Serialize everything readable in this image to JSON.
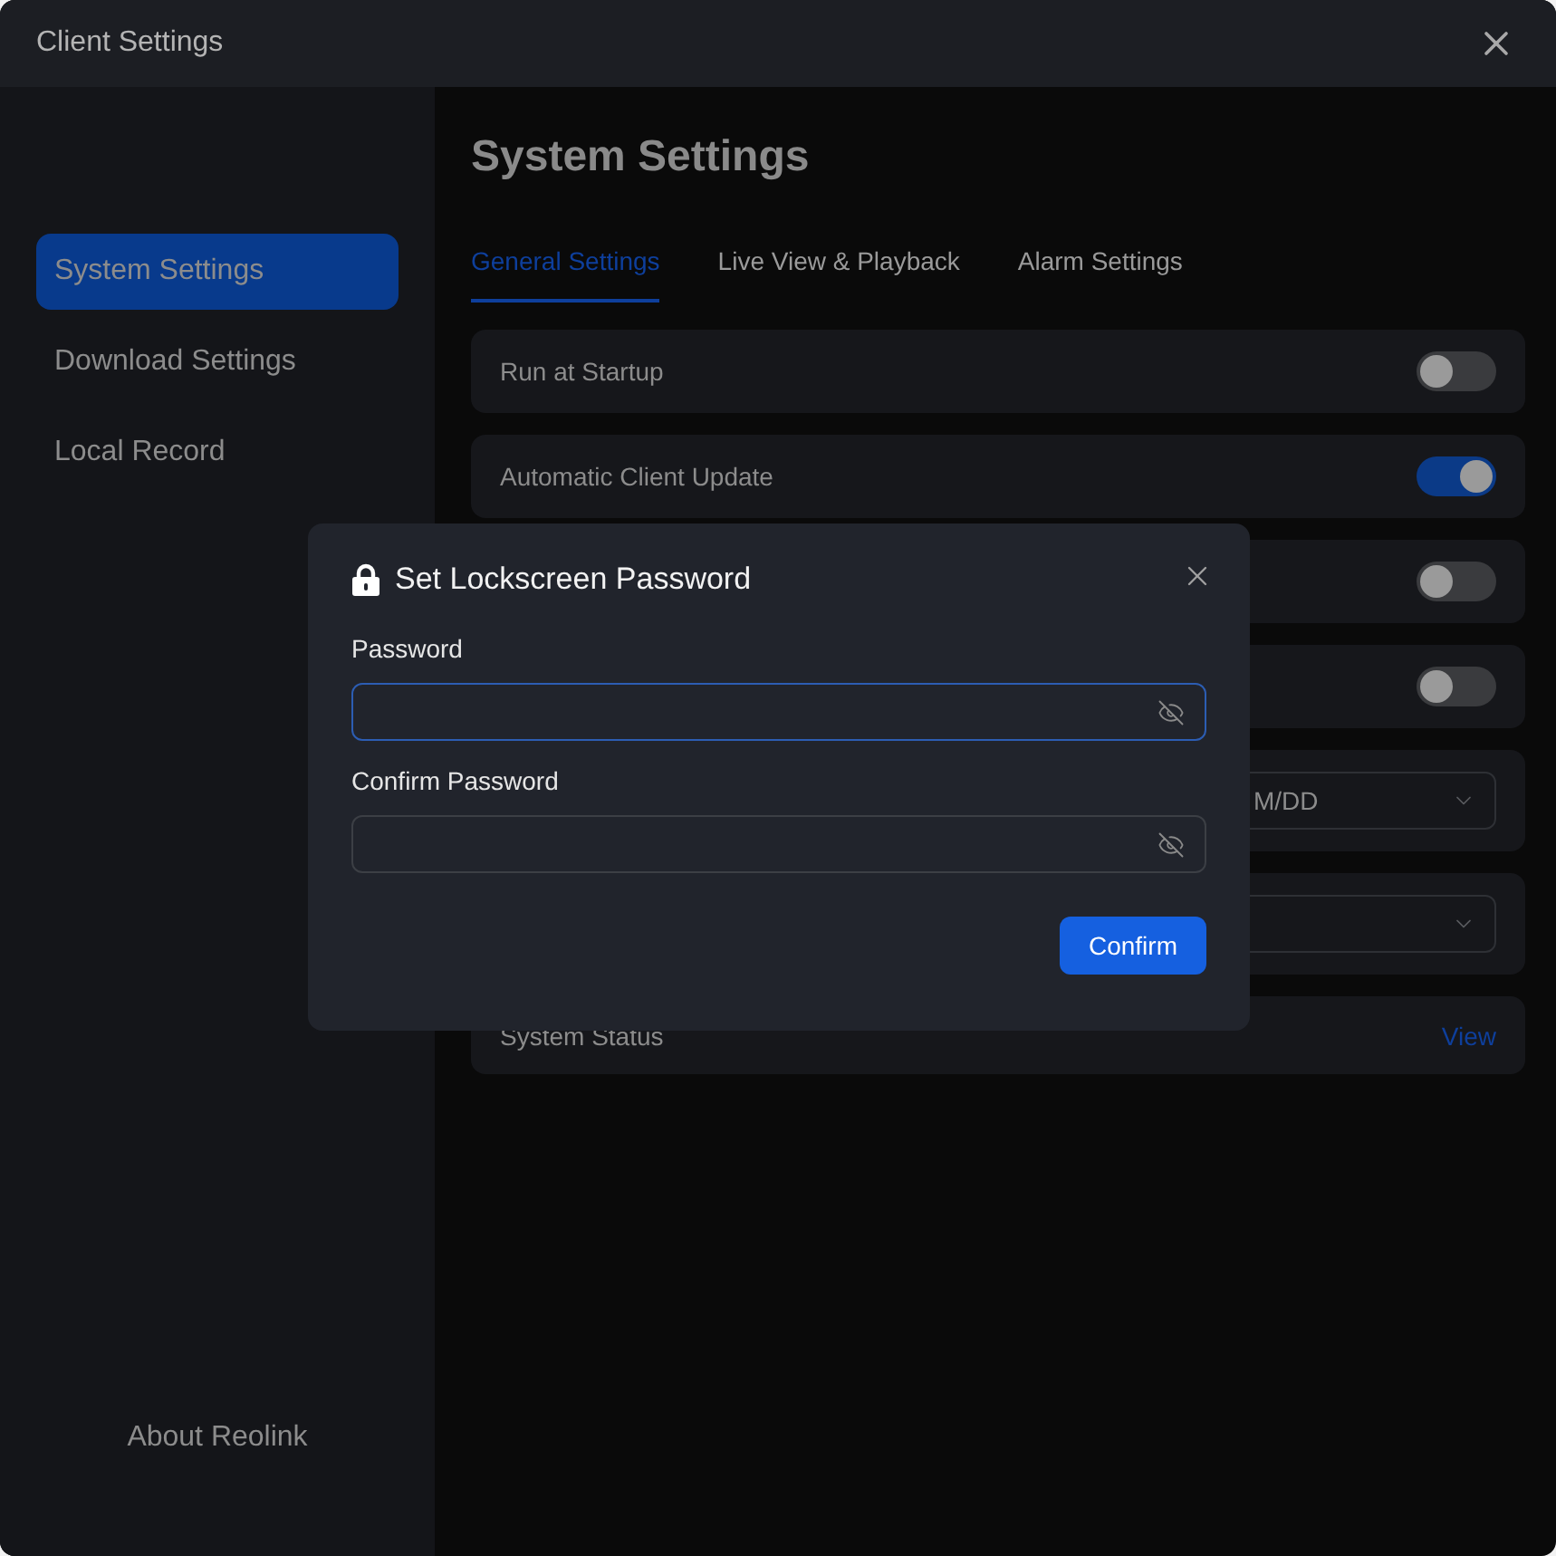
{
  "window": {
    "title": "Client Settings"
  },
  "sidebar": {
    "items": [
      {
        "label": "System Settings",
        "selected": true
      },
      {
        "label": "Download Settings",
        "selected": false
      },
      {
        "label": "Local Record",
        "selected": false
      }
    ],
    "footer": "About Reolink"
  },
  "content": {
    "title": "System Settings",
    "tabs": [
      {
        "label": "General Settings",
        "selected": true
      },
      {
        "label": "Live View & Playback",
        "selected": false
      },
      {
        "label": "Alarm Settings",
        "selected": false
      }
    ],
    "rows": [
      {
        "kind": "toggle",
        "label": "Run at Startup",
        "on": false
      },
      {
        "kind": "toggle",
        "label": "Automatic Client Update",
        "on": true
      },
      {
        "kind": "toggle",
        "on": false
      },
      {
        "kind": "toggle",
        "on": false
      },
      {
        "kind": "select",
        "value": "M/DD"
      },
      {
        "kind": "select"
      },
      {
        "kind": "link",
        "label": "System Status",
        "link": "View"
      }
    ]
  },
  "dialog": {
    "title": "Set Lockscreen Password",
    "fields": [
      {
        "label": "Password",
        "focused": true
      },
      {
        "label": "Confirm Password",
        "focused": false
      }
    ],
    "button": "Confirm"
  }
}
